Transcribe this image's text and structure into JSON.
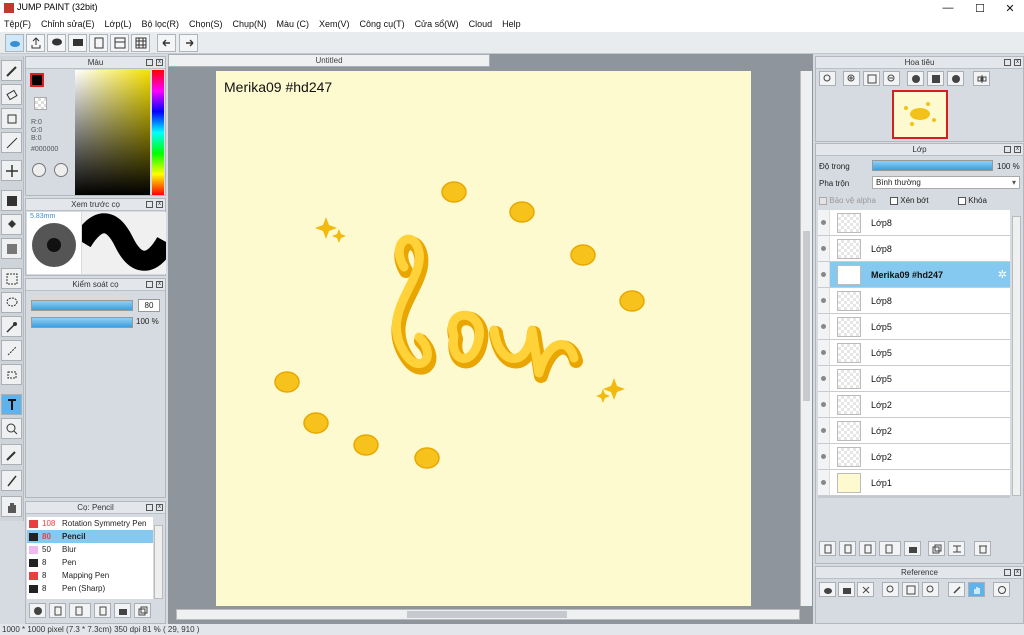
{
  "app": {
    "title": "JUMP PAINT (32bit)"
  },
  "menu": [
    "Tệp(F)",
    "Chỉnh sửa(E)",
    "Lớp(L)",
    "Bộ lọc(R)",
    "Chọn(S)",
    "Chụp(N)",
    "Màu (C)",
    "Xem(V)",
    "Công cụ(T)",
    "Cửa sổ(W)",
    "Cloud",
    "Help"
  ],
  "color_panel": {
    "title": "Màu",
    "r": "R:0",
    "g": "G:0",
    "b": "B:0",
    "hex": "#000000",
    "accent": "#e02020"
  },
  "brush_preview": {
    "title": "Xem trước cọ",
    "size": "5.83mm"
  },
  "brush_control": {
    "title": "Kiểm soát cọ",
    "size_value": "80",
    "opacity_value": "100 %"
  },
  "brush_list": {
    "title": "Cọ: Pencil",
    "items": [
      {
        "size": "108",
        "name": "Rotation Symmetry Pen",
        "color": "#e84040"
      },
      {
        "size": "80",
        "name": "Pencil",
        "color": "#222222"
      },
      {
        "size": "50",
        "name": "Blur",
        "color": "#f0b8f0"
      },
      {
        "size": "8",
        "name": "Pen",
        "color": "#222222"
      },
      {
        "size": "8",
        "name": "Mapping Pen",
        "color": "#e84040"
      },
      {
        "size": "8",
        "name": "Pen (Sharp)",
        "color": "#222222"
      }
    ]
  },
  "document": {
    "tab": "Untitled",
    "watermark_text": "Merika09  #hd247",
    "lettering": "Sou"
  },
  "navigator": {
    "title": "Hoa tiêu"
  },
  "layers": {
    "title": "Lớp",
    "opacity_label": "Độ trong",
    "opacity_value": "100 %",
    "blend_label": "Pha trộn",
    "blend_value": "Bình thường",
    "protect_alpha": "Bảo vệ alpha",
    "clipping": "Xén bớt",
    "lock": "Khóa",
    "items": [
      "Lớp8",
      "Lớp8",
      "Merika09  #hd247",
      "Lớp8",
      "Lớp5",
      "Lớp5",
      "Lớp5",
      "Lớp2",
      "Lớp2",
      "Lớp2",
      "Lớp1"
    ],
    "selected_index": 2
  },
  "reference": {
    "title": "Reference"
  },
  "status": "1000 * 1000 pixel   (7.3 * 7.3cm)   350 dpi   81 %   ( 29, 910 )"
}
